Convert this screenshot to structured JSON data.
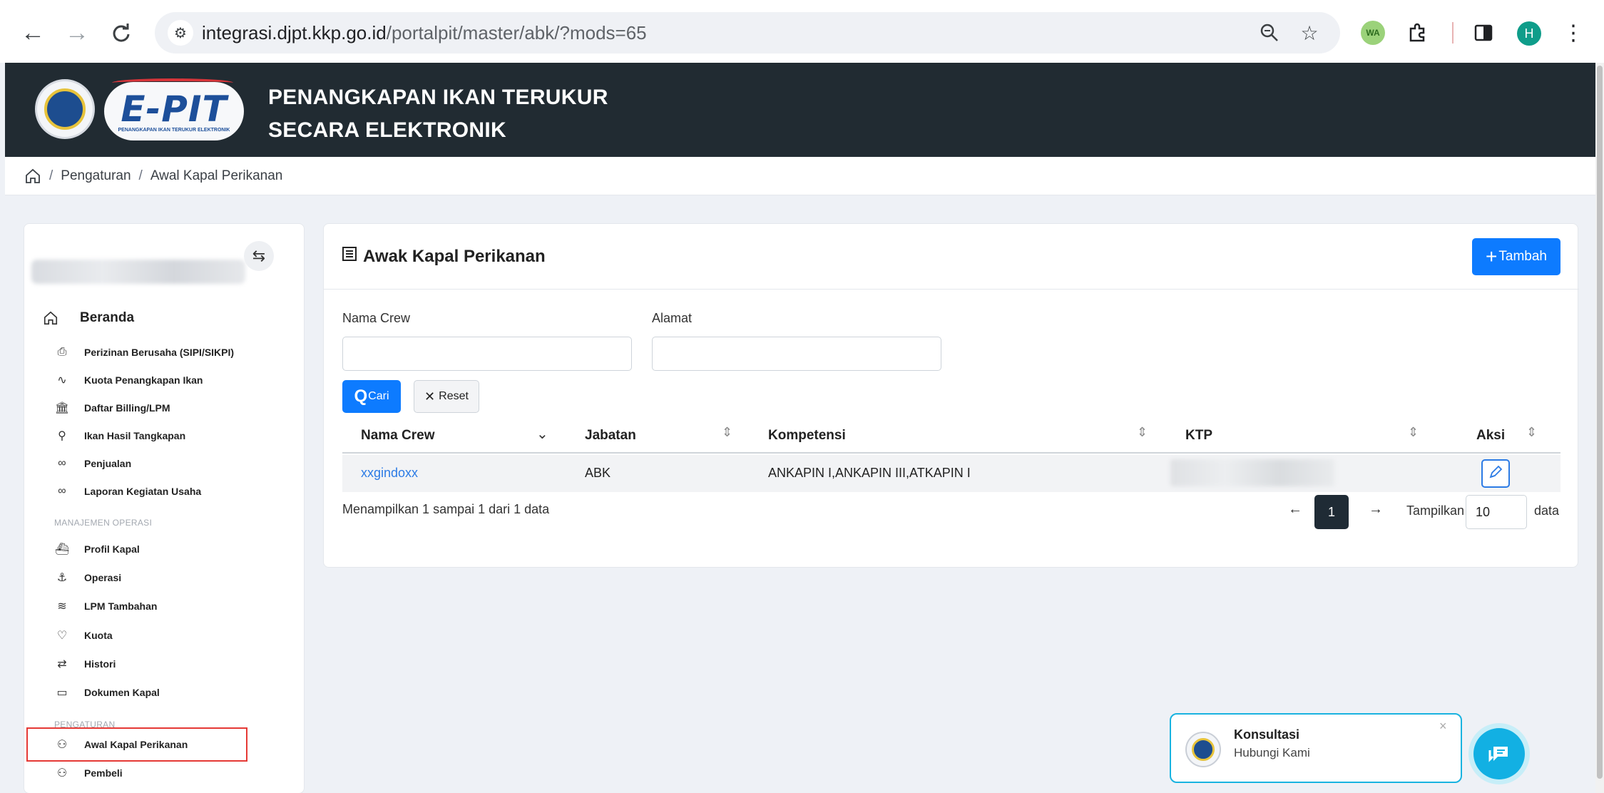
{
  "browser": {
    "url_host": "integrasi.djpt.kkp.go.id",
    "url_path": "/portalpit/master/abk/?mods=65",
    "profile_initial": "H",
    "ext_badge": "WA"
  },
  "header": {
    "logo_text": "E-PIT",
    "logo_subtext": "PENANGKAPAN IKAN TERUKUR ELEKTRONIK",
    "title_line1": "PENANGKAPAN IKAN TERUKUR",
    "title_line2": "SECARA ELEKTRONIK"
  },
  "breadcrumb": {
    "separator": "/",
    "items": [
      "Pengaturan",
      "Awal Kapal Perikanan"
    ]
  },
  "sidebar": {
    "home_label": "Beranda",
    "items_top": [
      {
        "label": "Perizinan Berusaha (SIPI/SIKPI)",
        "icon": "document-icon"
      },
      {
        "label": "Kuota Penangkapan Ikan",
        "icon": "activity-icon"
      },
      {
        "label": "Daftar Billing/LPM",
        "icon": "bank-icon"
      },
      {
        "label": "Ikan Hasil Tangkapan",
        "icon": "fish-icon"
      },
      {
        "label": "Penjualan",
        "icon": "handshake-icon"
      },
      {
        "label": "Laporan Kegiatan Usaha",
        "icon": "handshake-icon"
      }
    ],
    "section_operasi": "MANAJEMEN OPERASI",
    "items_operasi": [
      {
        "label": "Profil Kapal",
        "icon": "ship-icon"
      },
      {
        "label": "Operasi",
        "icon": "anchor-icon"
      },
      {
        "label": "LPM Tambahan",
        "icon": "layers-icon"
      },
      {
        "label": "Kuota",
        "icon": "heart-icon"
      },
      {
        "label": "Histori",
        "icon": "repeat-icon"
      },
      {
        "label": "Dokumen Kapal",
        "icon": "archive-icon"
      }
    ],
    "section_pengaturan": "PENGATURAN",
    "items_pengaturan": [
      {
        "label": "Awal Kapal Perikanan",
        "icon": "users-icon"
      },
      {
        "label": "Pembeli",
        "icon": "user-group-icon"
      }
    ]
  },
  "main": {
    "title": "Awak Kapal Perikanan",
    "add_button": "Tambah",
    "filters": {
      "name_label": "Nama Crew",
      "name_value": "",
      "address_label": "Alamat",
      "address_value": "",
      "search_button": "Cari",
      "reset_button": "Reset"
    },
    "table": {
      "columns": [
        "Nama Crew",
        "Jabatan",
        "Kompetensi",
        "KTP",
        "Aksi"
      ],
      "rows": [
        {
          "nama": "xxgindoxx",
          "jabatan": "ABK",
          "kompetensi": "ANKAPIN I,ANKAPIN III,ATKAPIN I"
        }
      ]
    },
    "info": "Menampilkan 1 sampai 1 dari 1 data",
    "pager": {
      "prev": "←",
      "current": "1",
      "next": "→"
    },
    "show_label": "Tampilkan",
    "show_value": "10",
    "data_label": "data"
  },
  "konsultasi": {
    "title": "Konsultasi",
    "subtitle": "Hubungi Kami",
    "close": "×"
  },
  "colors": {
    "header_bg": "#212b32",
    "primary": "#0d7bff",
    "link": "#2c7be5",
    "active_outline": "#e53935",
    "chat": "#12b0e3"
  }
}
